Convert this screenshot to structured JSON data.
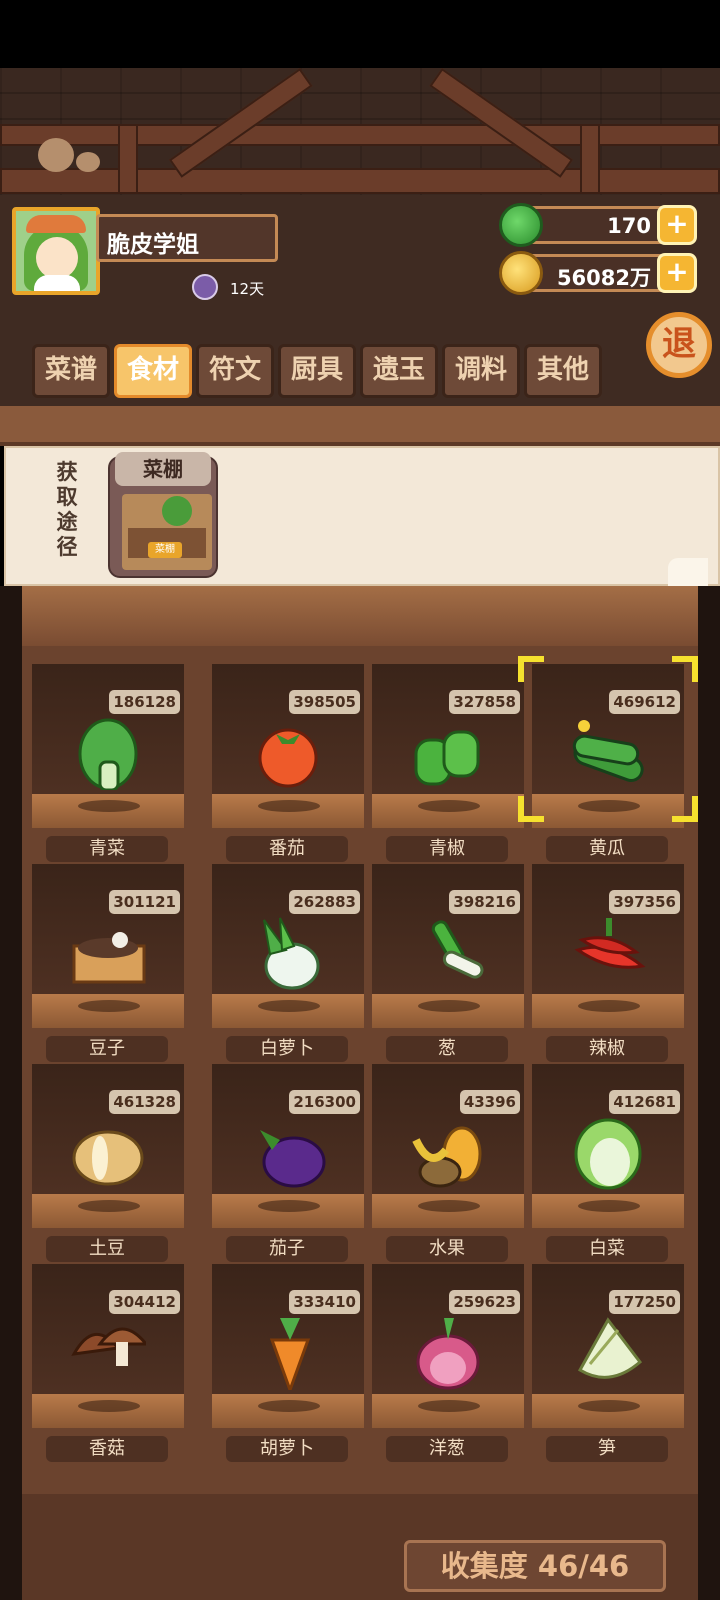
{
  "player": {
    "name": "脆皮学姐",
    "days": "12天"
  },
  "resources": {
    "jade": "170",
    "coins": "56082万"
  },
  "exit_label": "退",
  "tabs": [
    "菜谱",
    "食材",
    "符文",
    "厨具",
    "遗玉",
    "调料",
    "其他"
  ],
  "active_tab": "食材",
  "source": {
    "title": "获取途径",
    "name": "菜棚",
    "tag": "菜棚"
  },
  "ingredients": [
    {
      "name": "青菜",
      "count": "186128",
      "icon": "bok-choy-icon"
    },
    {
      "name": "番茄",
      "count": "398505",
      "icon": "tomato-icon"
    },
    {
      "name": "青椒",
      "count": "327858",
      "icon": "green-pepper-icon"
    },
    {
      "name": "黄瓜",
      "count": "469612",
      "icon": "cucumber-icon"
    },
    {
      "name": "豆子",
      "count": "301121",
      "icon": "beans-box-icon"
    },
    {
      "name": "白萝卜",
      "count": "262883",
      "icon": "white-radish-icon"
    },
    {
      "name": "葱",
      "count": "398216",
      "icon": "scallion-icon"
    },
    {
      "name": "辣椒",
      "count": "397356",
      "icon": "chili-icon"
    },
    {
      "name": "土豆",
      "count": "461328",
      "icon": "potato-icon"
    },
    {
      "name": "茄子",
      "count": "216300",
      "icon": "eggplant-icon"
    },
    {
      "name": "水果",
      "count": "43396",
      "icon": "fruit-icon"
    },
    {
      "name": "白菜",
      "count": "412681",
      "icon": "napa-cabbage-icon"
    },
    {
      "name": "香菇",
      "count": "304412",
      "icon": "mushroom-icon"
    },
    {
      "name": "胡萝卜",
      "count": "333410",
      "icon": "carrot-icon"
    },
    {
      "name": "洋葱",
      "count": "259623",
      "icon": "onion-icon"
    },
    {
      "name": "笋",
      "count": "177250",
      "icon": "bamboo-shoot-icon"
    }
  ],
  "selected_ingredient": "黄瓜",
  "collection": "收集度 46/46",
  "colors": {
    "wood": "#6b432e",
    "accent": "#f7c56a",
    "select": "#f6e12e"
  }
}
